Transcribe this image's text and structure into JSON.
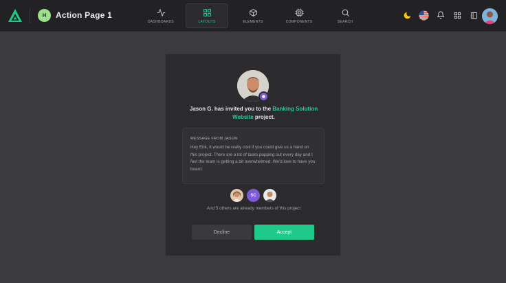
{
  "header": {
    "page_avatar_initial": "H",
    "page_title": "Action Page 1",
    "nav": [
      {
        "label": "DASHBOARDS",
        "icon": "activity-icon",
        "active": false
      },
      {
        "label": "LAYOUTS",
        "icon": "grid-icon",
        "active": true
      },
      {
        "label": "ELEMENTS",
        "icon": "box-icon",
        "active": false
      },
      {
        "label": "COMPONENTS",
        "icon": "cpu-icon",
        "active": false
      },
      {
        "label": "SEARCH",
        "icon": "search-icon",
        "active": false
      }
    ],
    "right_icons": [
      "moon-icon",
      "us-flag-icon",
      "bell-icon",
      "grid-icon",
      "sidebar-icon",
      "user-avatar"
    ]
  },
  "invite": {
    "text_before": "Jason G. has invited you to the ",
    "project_name": "Banking Solution Website",
    "text_after": " project.",
    "message_label": "MESSAGE FROM JASON",
    "message_body": "Hey Erik, it would be really cool if you could give us a hand on this project. There are a lot of tasks popping out every day and I feel the team is getting a bit overwhelmed. We'd love to have you board.",
    "members": [
      {
        "type": "photo",
        "name": "member-avatar-1"
      },
      {
        "type": "initials",
        "initials": "SC"
      },
      {
        "type": "photo",
        "name": "member-avatar-3"
      }
    ],
    "members_note": "And 5 others are already members of this project",
    "decline_label": "Decline",
    "accept_label": "Accept"
  },
  "colors": {
    "accent": "#29cc9a",
    "accept_button": "#1fc98a",
    "badge_purple": "#7d5bd6",
    "topbar_bg": "#222224",
    "page_bg": "#3b3b3e",
    "card_bg": "#2b2b2e"
  }
}
